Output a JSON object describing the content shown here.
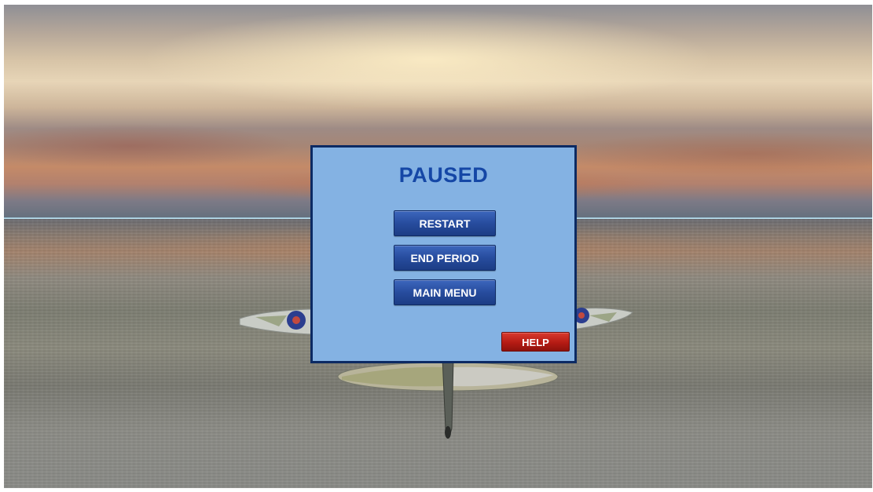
{
  "pause_menu": {
    "title": "PAUSED",
    "buttons": {
      "restart": "RESTART",
      "end_period": "END PERIOD",
      "main_menu": "MAIN MENU",
      "help": "HELP"
    }
  },
  "colors": {
    "panel_background": "#84b2e3",
    "panel_border": "#0c2a63",
    "title_text": "#1547a6",
    "menu_button": "#274c9e",
    "help_button": "#b51b14"
  },
  "scene": {
    "background": "sunset sky over sea",
    "aircraft": "propeller fighter plane, rear view, roundel markings"
  }
}
